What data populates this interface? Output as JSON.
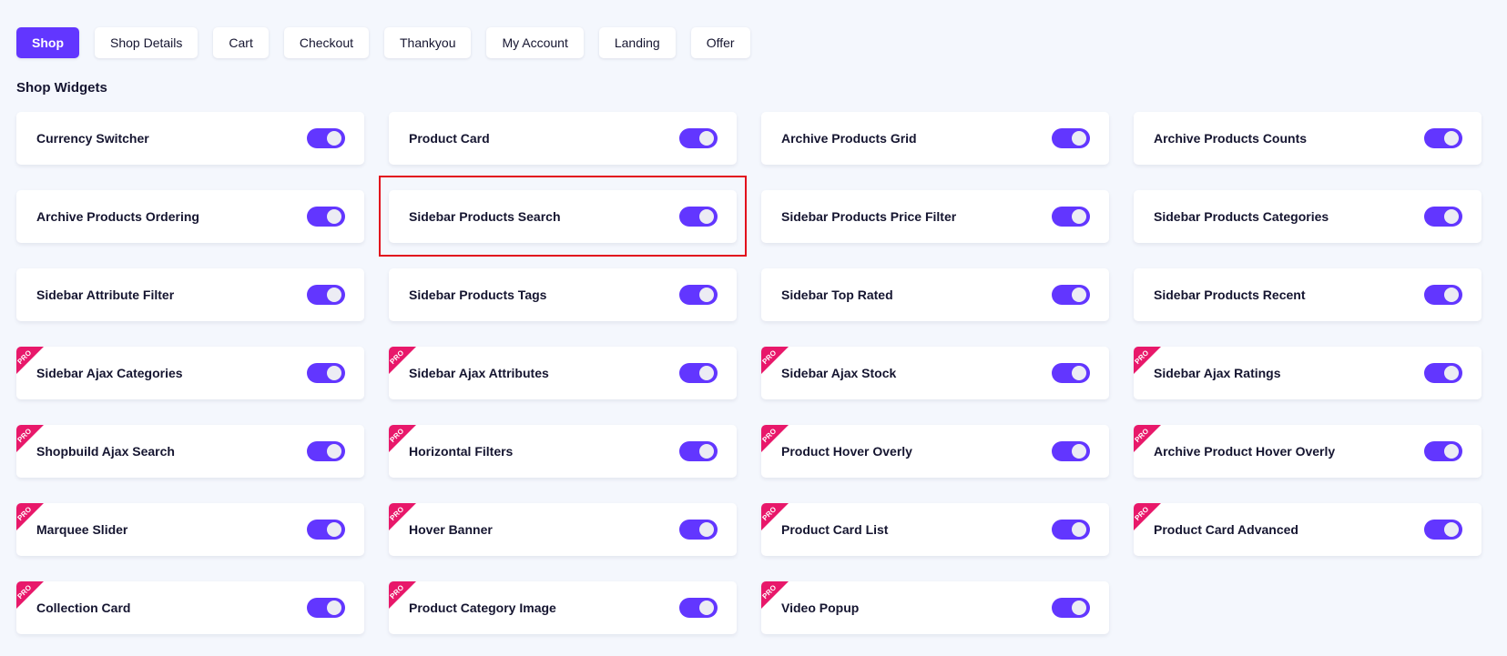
{
  "tabs": [
    {
      "label": "Shop",
      "active": true
    },
    {
      "label": "Shop Details"
    },
    {
      "label": "Cart"
    },
    {
      "label": "Checkout"
    },
    {
      "label": "Thankyou"
    },
    {
      "label": "My Account"
    },
    {
      "label": "Landing"
    },
    {
      "label": "Offer"
    }
  ],
  "section_title": "Shop Widgets",
  "pro_badge_label": "PRO",
  "colors": {
    "accent": "#6236ff",
    "pro_ribbon": "#e8186a",
    "highlight_border": "#e2101d",
    "background": "#f4f7fd"
  },
  "widgets": [
    {
      "label": "Currency Switcher",
      "enabled": true,
      "pro": false
    },
    {
      "label": "Product Card",
      "enabled": true,
      "pro": false
    },
    {
      "label": "Archive Products Grid",
      "enabled": true,
      "pro": false
    },
    {
      "label": "Archive Products Counts",
      "enabled": true,
      "pro": false
    },
    {
      "label": "Archive Products Ordering",
      "enabled": true,
      "pro": false
    },
    {
      "label": "Sidebar Products Search",
      "enabled": true,
      "pro": false,
      "highlighted": true
    },
    {
      "label": "Sidebar Products Price Filter",
      "enabled": true,
      "pro": false
    },
    {
      "label": "Sidebar Products Categories",
      "enabled": true,
      "pro": false
    },
    {
      "label": "Sidebar Attribute Filter",
      "enabled": true,
      "pro": false
    },
    {
      "label": "Sidebar Products Tags",
      "enabled": true,
      "pro": false
    },
    {
      "label": "Sidebar Top Rated",
      "enabled": true,
      "pro": false
    },
    {
      "label": "Sidebar Products Recent",
      "enabled": true,
      "pro": false
    },
    {
      "label": "Sidebar Ajax Categories",
      "enabled": true,
      "pro": true
    },
    {
      "label": "Sidebar Ajax Attributes",
      "enabled": true,
      "pro": true
    },
    {
      "label": "Sidebar Ajax Stock",
      "enabled": true,
      "pro": true
    },
    {
      "label": "Sidebar Ajax Ratings",
      "enabled": true,
      "pro": true
    },
    {
      "label": "Shopbuild Ajax Search",
      "enabled": true,
      "pro": true
    },
    {
      "label": "Horizontal Filters",
      "enabled": true,
      "pro": true
    },
    {
      "label": "Product Hover Overly",
      "enabled": true,
      "pro": true
    },
    {
      "label": "Archive Product Hover Overly",
      "enabled": true,
      "pro": true
    },
    {
      "label": "Marquee Slider",
      "enabled": true,
      "pro": true
    },
    {
      "label": "Hover Banner",
      "enabled": true,
      "pro": true
    },
    {
      "label": "Product Card List",
      "enabled": true,
      "pro": true
    },
    {
      "label": "Product Card Advanced",
      "enabled": true,
      "pro": true
    },
    {
      "label": "Collection Card",
      "enabled": true,
      "pro": true
    },
    {
      "label": "Product Category Image",
      "enabled": true,
      "pro": true
    },
    {
      "label": "Video Popup",
      "enabled": true,
      "pro": true
    }
  ]
}
